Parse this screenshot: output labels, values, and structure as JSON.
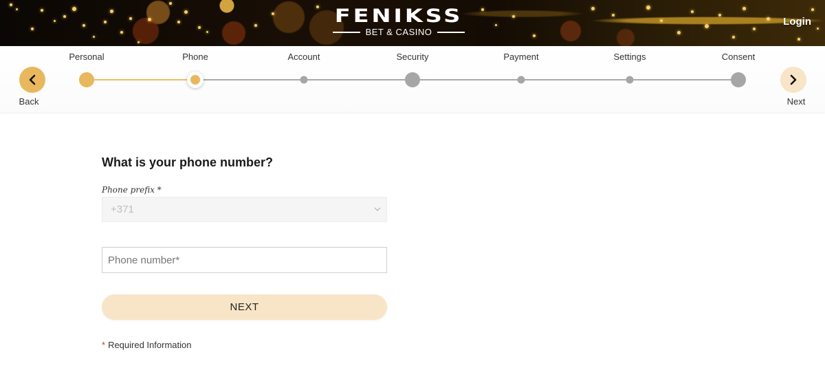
{
  "header": {
    "brand_name": "FENIKSS",
    "brand_tagline": "BET & CASINO",
    "login_label": "Login"
  },
  "stepper": {
    "back_label": "Back",
    "next_label": "Next",
    "current_step": 2,
    "total_steps": 7,
    "steps": [
      {
        "label": "Personal",
        "state": "done"
      },
      {
        "label": "Phone",
        "state": "current"
      },
      {
        "label": "Account",
        "state": "pending"
      },
      {
        "label": "Security",
        "state": "pending-major"
      },
      {
        "label": "Payment",
        "state": "pending"
      },
      {
        "label": "Settings",
        "state": "pending"
      },
      {
        "label": "Consent",
        "state": "pending-major"
      }
    ],
    "colors": {
      "done": "#e8b75e",
      "pending": "#a6a6a6",
      "next_button": "#f8e4c6"
    }
  },
  "form": {
    "title": "What is your phone number?",
    "prefix_label": "Phone prefix *",
    "prefix_value": "+371",
    "phone_placeholder": "Phone number*",
    "phone_value": "",
    "submit_label": "NEXT",
    "required_star": "*",
    "required_note": "Required Information"
  }
}
